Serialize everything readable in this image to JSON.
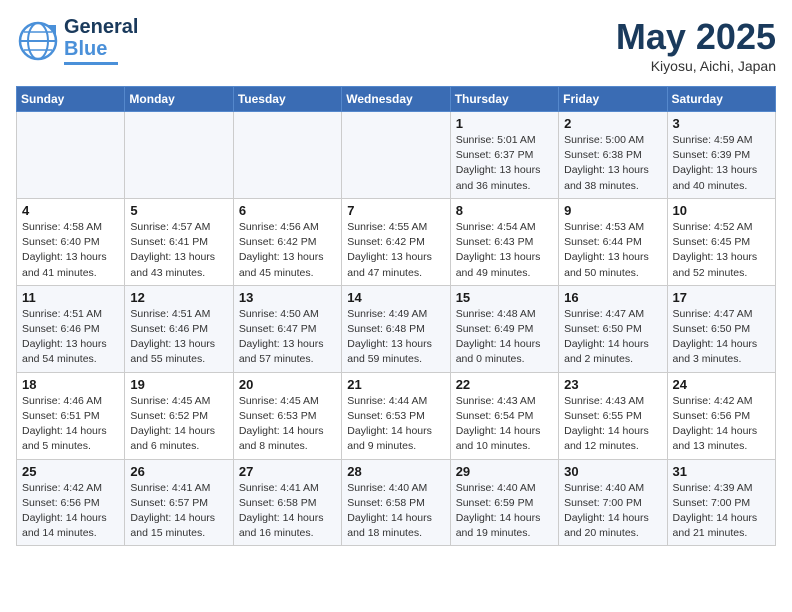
{
  "header": {
    "logo_line1": "General",
    "logo_line2": "Blue",
    "month": "May 2025",
    "location": "Kiyosu, Aichi, Japan"
  },
  "weekdays": [
    "Sunday",
    "Monday",
    "Tuesday",
    "Wednesday",
    "Thursday",
    "Friday",
    "Saturday"
  ],
  "weeks": [
    [
      {
        "day": "",
        "info": ""
      },
      {
        "day": "",
        "info": ""
      },
      {
        "day": "",
        "info": ""
      },
      {
        "day": "",
        "info": ""
      },
      {
        "day": "1",
        "info": "Sunrise: 5:01 AM\nSunset: 6:37 PM\nDaylight: 13 hours\nand 36 minutes."
      },
      {
        "day": "2",
        "info": "Sunrise: 5:00 AM\nSunset: 6:38 PM\nDaylight: 13 hours\nand 38 minutes."
      },
      {
        "day": "3",
        "info": "Sunrise: 4:59 AM\nSunset: 6:39 PM\nDaylight: 13 hours\nand 40 minutes."
      }
    ],
    [
      {
        "day": "4",
        "info": "Sunrise: 4:58 AM\nSunset: 6:40 PM\nDaylight: 13 hours\nand 41 minutes."
      },
      {
        "day": "5",
        "info": "Sunrise: 4:57 AM\nSunset: 6:41 PM\nDaylight: 13 hours\nand 43 minutes."
      },
      {
        "day": "6",
        "info": "Sunrise: 4:56 AM\nSunset: 6:42 PM\nDaylight: 13 hours\nand 45 minutes."
      },
      {
        "day": "7",
        "info": "Sunrise: 4:55 AM\nSunset: 6:42 PM\nDaylight: 13 hours\nand 47 minutes."
      },
      {
        "day": "8",
        "info": "Sunrise: 4:54 AM\nSunset: 6:43 PM\nDaylight: 13 hours\nand 49 minutes."
      },
      {
        "day": "9",
        "info": "Sunrise: 4:53 AM\nSunset: 6:44 PM\nDaylight: 13 hours\nand 50 minutes."
      },
      {
        "day": "10",
        "info": "Sunrise: 4:52 AM\nSunset: 6:45 PM\nDaylight: 13 hours\nand 52 minutes."
      }
    ],
    [
      {
        "day": "11",
        "info": "Sunrise: 4:51 AM\nSunset: 6:46 PM\nDaylight: 13 hours\nand 54 minutes."
      },
      {
        "day": "12",
        "info": "Sunrise: 4:51 AM\nSunset: 6:46 PM\nDaylight: 13 hours\nand 55 minutes."
      },
      {
        "day": "13",
        "info": "Sunrise: 4:50 AM\nSunset: 6:47 PM\nDaylight: 13 hours\nand 57 minutes."
      },
      {
        "day": "14",
        "info": "Sunrise: 4:49 AM\nSunset: 6:48 PM\nDaylight: 13 hours\nand 59 minutes."
      },
      {
        "day": "15",
        "info": "Sunrise: 4:48 AM\nSunset: 6:49 PM\nDaylight: 14 hours\nand 0 minutes."
      },
      {
        "day": "16",
        "info": "Sunrise: 4:47 AM\nSunset: 6:50 PM\nDaylight: 14 hours\nand 2 minutes."
      },
      {
        "day": "17",
        "info": "Sunrise: 4:47 AM\nSunset: 6:50 PM\nDaylight: 14 hours\nand 3 minutes."
      }
    ],
    [
      {
        "day": "18",
        "info": "Sunrise: 4:46 AM\nSunset: 6:51 PM\nDaylight: 14 hours\nand 5 minutes."
      },
      {
        "day": "19",
        "info": "Sunrise: 4:45 AM\nSunset: 6:52 PM\nDaylight: 14 hours\nand 6 minutes."
      },
      {
        "day": "20",
        "info": "Sunrise: 4:45 AM\nSunset: 6:53 PM\nDaylight: 14 hours\nand 8 minutes."
      },
      {
        "day": "21",
        "info": "Sunrise: 4:44 AM\nSunset: 6:53 PM\nDaylight: 14 hours\nand 9 minutes."
      },
      {
        "day": "22",
        "info": "Sunrise: 4:43 AM\nSunset: 6:54 PM\nDaylight: 14 hours\nand 10 minutes."
      },
      {
        "day": "23",
        "info": "Sunrise: 4:43 AM\nSunset: 6:55 PM\nDaylight: 14 hours\nand 12 minutes."
      },
      {
        "day": "24",
        "info": "Sunrise: 4:42 AM\nSunset: 6:56 PM\nDaylight: 14 hours\nand 13 minutes."
      }
    ],
    [
      {
        "day": "25",
        "info": "Sunrise: 4:42 AM\nSunset: 6:56 PM\nDaylight: 14 hours\nand 14 minutes."
      },
      {
        "day": "26",
        "info": "Sunrise: 4:41 AM\nSunset: 6:57 PM\nDaylight: 14 hours\nand 15 minutes."
      },
      {
        "day": "27",
        "info": "Sunrise: 4:41 AM\nSunset: 6:58 PM\nDaylight: 14 hours\nand 16 minutes."
      },
      {
        "day": "28",
        "info": "Sunrise: 4:40 AM\nSunset: 6:58 PM\nDaylight: 14 hours\nand 18 minutes."
      },
      {
        "day": "29",
        "info": "Sunrise: 4:40 AM\nSunset: 6:59 PM\nDaylight: 14 hours\nand 19 minutes."
      },
      {
        "day": "30",
        "info": "Sunrise: 4:40 AM\nSunset: 7:00 PM\nDaylight: 14 hours\nand 20 minutes."
      },
      {
        "day": "31",
        "info": "Sunrise: 4:39 AM\nSunset: 7:00 PM\nDaylight: 14 hours\nand 21 minutes."
      }
    ]
  ]
}
